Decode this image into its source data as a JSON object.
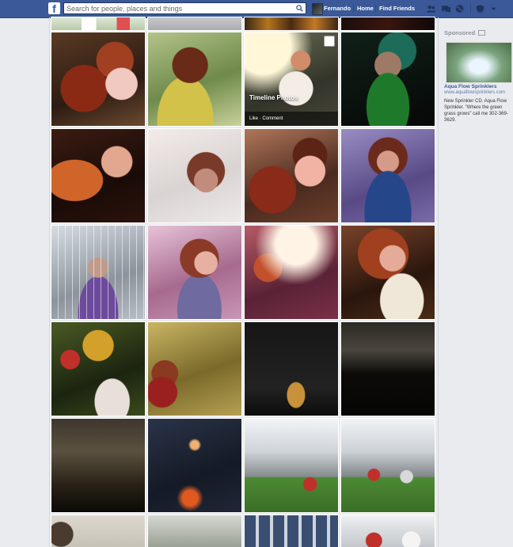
{
  "topbar": {
    "logo": "f",
    "search_placeholder": "Search for people, places and things",
    "user_name": "Fernando",
    "home": "Home",
    "find_friends": "Find Friends"
  },
  "album": {
    "hover_title": "Timeline Photos",
    "hover_actions": "Like · Comment"
  },
  "sidebar": {
    "sponsored": "Sponsored",
    "ad_title": "Aqua Flow Sprinklers",
    "ad_url": "www.aquaflowsprinklers.com",
    "ad_text": "New Sprinkler CD. Aqua Flow Sprinkler. \"Where the green grass grows\" call me 302-369-3629."
  },
  "colors": {
    "brand": "#3b5998",
    "link": "#3b5998",
    "page_bg": "#e9ebee"
  }
}
